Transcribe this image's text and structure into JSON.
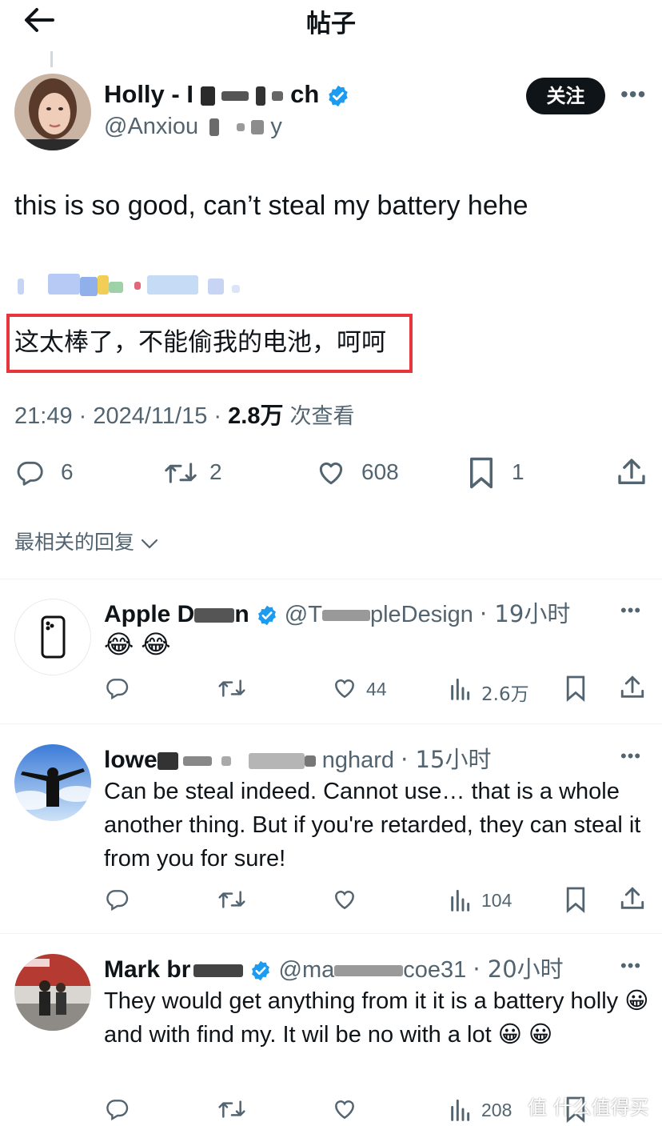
{
  "header": {
    "title": "帖子"
  },
  "post": {
    "display_name": "Holly - I",
    "display_name_tail": "ch",
    "handle": "@Anxiou",
    "handle_tail": "y",
    "follow_label": "关注",
    "text": "this is so good, can’t steal my battery hehe",
    "translation": "这太棒了，不能偷我的电池，呵呵",
    "time": "21:49",
    "date": "2024/11/15",
    "views_count": "2.8万",
    "views_label": "次查看",
    "replies": "6",
    "reposts": "2",
    "likes": "608",
    "bookmarks": "1"
  },
  "sort_label": "最相关的回复",
  "replies": [
    {
      "name_start": "Apple D",
      "name_end": "n",
      "handle_start": "@T",
      "handle_end": "pleDesign",
      "time": "· 19小时",
      "text": "😂 😂",
      "likes": "44",
      "views": "2.6万"
    },
    {
      "name_start": "lowe",
      "handle_end": "nghard",
      "time": "· 15小时",
      "text": "Can be steal indeed. Cannot use… that is a whole another thing. But if you're retarded, they can steal it from you for sure!",
      "likes": "",
      "views": "104"
    },
    {
      "name_start": "Mark br",
      "handle_start": "@ma",
      "handle_end": "coe31",
      "time": "· 20小时",
      "text": "They would get anything from it  it is a battery holly 😀  and with find my. It wil be no with a lot 😀 😀",
      "views": "208"
    }
  ],
  "watermark": "值 什么值得买",
  "colors": {
    "accent": "#1d9bf0",
    "red_box": "#e8353b",
    "secondary": "#536471",
    "text": "#0f1419"
  }
}
